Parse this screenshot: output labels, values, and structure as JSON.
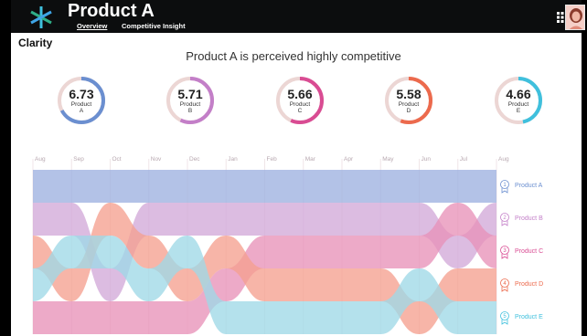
{
  "app": {
    "title": "Product A",
    "tabs": [
      "Overview",
      "Competitive Insight"
    ],
    "brand": "Clarity"
  },
  "headline": "Product A is perceived highly competitive",
  "products": [
    {
      "score": "6.73",
      "name": "Product A",
      "color": "#6b8fd0",
      "fraction": 0.673
    },
    {
      "score": "5.71",
      "name": "Product B",
      "color": "#c37fc8",
      "fraction": 0.571
    },
    {
      "score": "5.66",
      "name": "Product C",
      "color": "#d94c93",
      "fraction": 0.566
    },
    {
      "score": "5.58",
      "name": "Product D",
      "color": "#ec6a4d",
      "fraction": 0.558
    },
    {
      "score": "4.66",
      "name": "Product E",
      "color": "#3fc0dd",
      "fraction": 0.466
    }
  ],
  "chart_data": {
    "type": "bump",
    "months": [
      "Aug",
      "Sep",
      "Oct",
      "Nov",
      "Dec",
      "Jan",
      "Feb",
      "Mar",
      "Apr",
      "May",
      "Jun",
      "Jul",
      "Aug"
    ],
    "series": [
      {
        "name": "Product A",
        "color": "#9db1e0",
        "ranks": [
          1,
          1,
          1,
          1,
          1,
          1,
          1,
          1,
          1,
          1,
          1,
          1,
          1
        ]
      },
      {
        "name": "Product B",
        "color": "#d2a9d8",
        "ranks": [
          2,
          2,
          4,
          2,
          2,
          2,
          2,
          2,
          2,
          2,
          2,
          3,
          2
        ]
      },
      {
        "name": "Product C",
        "color": "#e892b9",
        "ranks": [
          5,
          5,
          5,
          5,
          5,
          4,
          3,
          3,
          3,
          3,
          3,
          2,
          3
        ]
      },
      {
        "name": "Product D",
        "color": "#f5a08f",
        "ranks": [
          3,
          4,
          2,
          3,
          4,
          3,
          4,
          4,
          4,
          4,
          5,
          4,
          4
        ]
      },
      {
        "name": "Product E",
        "color": "#9fd9e7",
        "ranks": [
          4,
          3,
          3,
          4,
          3,
          5,
          5,
          5,
          5,
          5,
          4,
          5,
          5
        ]
      }
    ],
    "legend": [
      {
        "rank": "1",
        "name": "Product A",
        "color": "#6b8fd0"
      },
      {
        "rank": "2",
        "name": "Product B",
        "color": "#c37fc8"
      },
      {
        "rank": "3",
        "name": "Product C",
        "color": "#d94c93"
      },
      {
        "rank": "4",
        "name": "Product D",
        "color": "#ec6a4d"
      },
      {
        "rank": "5",
        "name": "Product E",
        "color": "#3fc0dd"
      }
    ]
  }
}
